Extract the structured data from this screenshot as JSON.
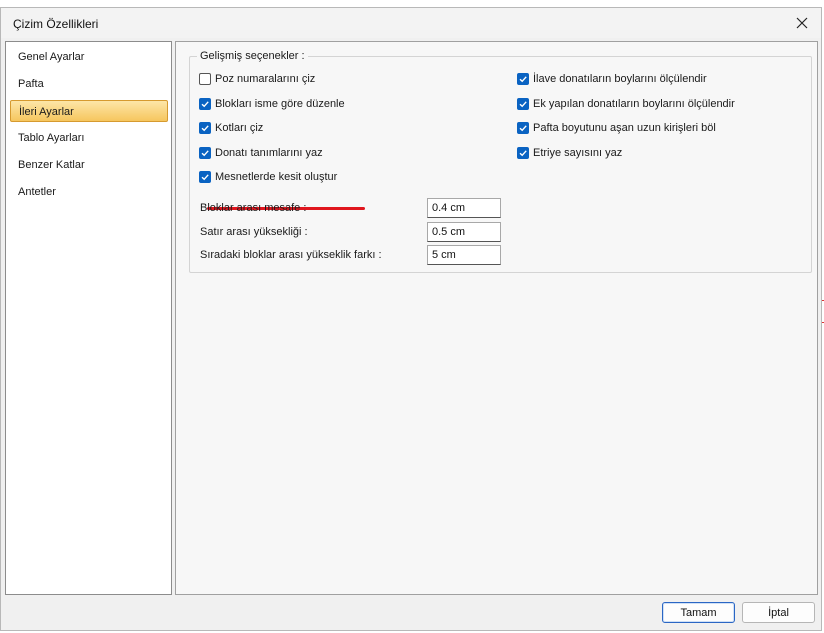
{
  "window": {
    "title": "Çizim Özellikleri"
  },
  "sidebar": {
    "items": [
      {
        "label": "Genel Ayarlar",
        "selected": false
      },
      {
        "label": "Pafta",
        "selected": false
      },
      {
        "label": "İleri Ayarlar",
        "selected": true
      },
      {
        "label": "Tablo Ayarları",
        "selected": false
      },
      {
        "label": "Benzer Katlar",
        "selected": false
      },
      {
        "label": "Antetler",
        "selected": false
      }
    ]
  },
  "advanced": {
    "group_title": "Gelişmiş seçenekler :",
    "left_options": [
      {
        "label": "Poz numaralarını çiz",
        "checked": false
      },
      {
        "label": "Blokları isme göre düzenle",
        "checked": true
      },
      {
        "label": "Kotları çiz",
        "checked": true
      },
      {
        "label": "Donatı tanımlarını yaz",
        "checked": true
      },
      {
        "label": "Mesnetlerde kesit oluştur",
        "checked": true,
        "highlighted": true
      }
    ],
    "right_options": [
      {
        "label": "İlave donatıların boylarını ölçülendir",
        "checked": true
      },
      {
        "label": "Ek yapılan donatıların boylarını ölçülendir",
        "checked": true
      },
      {
        "label": "Pafta boyutunu aşan uzun kirişleri böl",
        "checked": true
      },
      {
        "label": "Etriye sayısını yaz",
        "checked": true
      }
    ],
    "fields": [
      {
        "label": "Bloklar arası mesafe :",
        "value": "0.4 cm"
      },
      {
        "label": "Satır arası yüksekliği :",
        "value": "0.5 cm"
      },
      {
        "label": "Sıradaki bloklar arası yükseklik farkı :",
        "value": "5 cm"
      }
    ]
  },
  "buttons": {
    "ok": "Tamam",
    "cancel": "İptal"
  },
  "colors": {
    "checkbox": "#0a63c2",
    "selection": "#f6c65e",
    "annotation": "#e0161e"
  }
}
